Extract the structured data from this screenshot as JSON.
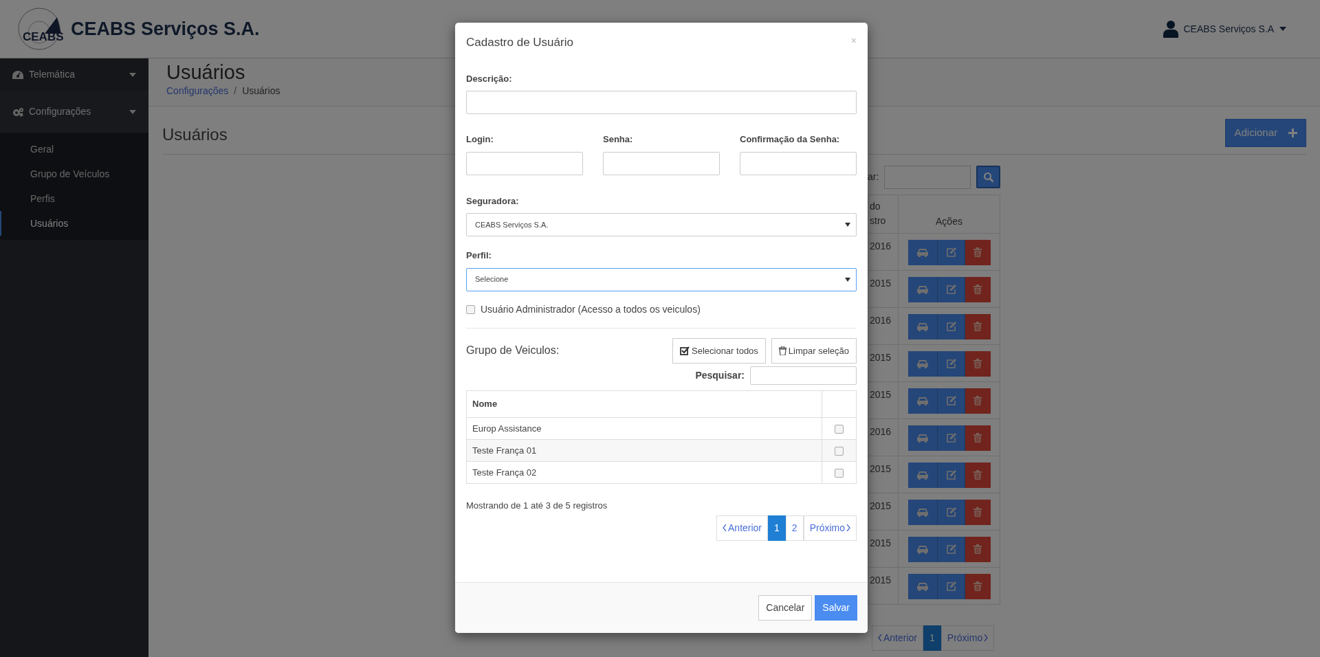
{
  "header": {
    "logo_text": "CEABS",
    "brand": "CEABS Serviços S.A.",
    "user": "CEABS Serviços S.A"
  },
  "sidebar": {
    "items": [
      {
        "label": "Telemática",
        "expanded": false
      },
      {
        "label": "Configurações",
        "expanded": true,
        "children": [
          {
            "label": "Geral",
            "selected": false
          },
          {
            "label": "Grupo de Veículos",
            "selected": false
          },
          {
            "label": "Perfis",
            "selected": false
          },
          {
            "label": "Usuários",
            "selected": true
          }
        ]
      }
    ]
  },
  "page": {
    "title": "Usuários",
    "breadcrumb_separator": "/",
    "breadcrumb": [
      {
        "label": "Configurações",
        "kind": "link"
      },
      {
        "label": "Usuários",
        "kind": "current"
      }
    ]
  },
  "panel": {
    "title": "Usuários",
    "add_button": "Adicionar",
    "search_label": "ar:",
    "table": {
      "column_1": [
        "do",
        "stro"
      ],
      "column_2": "Ações",
      "rows": [
        {
          "column_1": "2016"
        },
        {
          "column_1": "2015"
        },
        {
          "column_1": "2016"
        },
        {
          "column_1": "2015"
        },
        {
          "column_1": "2015"
        },
        {
          "column_1": "2016"
        },
        {
          "column_1": "2015"
        },
        {
          "column_1": "2015"
        },
        {
          "column_1": "2015"
        },
        {
          "column_1": "2015"
        }
      ]
    },
    "pagination": [
      {
        "label": "Anterior",
        "kind": "prev",
        "selected": false
      },
      {
        "label": "1",
        "kind": "page",
        "selected": true
      },
      {
        "label": "Próximo",
        "kind": "next",
        "selected": false
      }
    ]
  },
  "modal": {
    "title": "Cadastro de Usuário",
    "close": "×",
    "descricao": {
      "label": "Descrição:"
    },
    "credentials": [
      {
        "label": "Login:"
      },
      {
        "label": "Senha:"
      },
      {
        "label": "Confirmação da Senha:"
      }
    ],
    "selects": [
      {
        "label": "Seguradora:",
        "value": "CEABS Serviços S.A.",
        "focused": false
      },
      {
        "label": "Perfil:",
        "value": "Selecione",
        "focused": true
      }
    ],
    "admin": {
      "label": "Usuário Administrador (Acesso a todos os veiculos)",
      "checked": false
    },
    "group": {
      "title": "Grupo de Veiculos:",
      "buttons": [
        {
          "label": "Selecionar todos",
          "kind": "select"
        },
        {
          "label": "Limpar seleção",
          "kind": "clear"
        }
      ],
      "search_label": "Pesquisar:",
      "column": "Nome",
      "rows": [
        {
          "name": "Europ Assistance",
          "checked": false
        },
        {
          "name": "Teste França 01",
          "checked": false
        },
        {
          "name": "Teste França 02",
          "checked": false
        }
      ],
      "info": "Mostrando de 1 até 3 de 5 registros",
      "pagination": [
        {
          "label": "Anterior",
          "kind": "prev",
          "selected": false
        },
        {
          "label": "1",
          "kind": "page",
          "selected": true
        },
        {
          "label": "2",
          "kind": "page",
          "selected": false
        },
        {
          "label": "Próximo",
          "kind": "next",
          "selected": false
        }
      ]
    },
    "footer": [
      {
        "label": "Cancelar",
        "kind": "default"
      },
      {
        "label": "Salvar",
        "kind": "primary"
      }
    ]
  }
}
